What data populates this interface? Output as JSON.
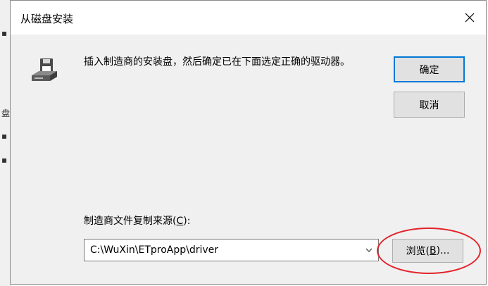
{
  "background_window": {
    "fragments": [
      "▪",
      "盘",
      "▪",
      "▪"
    ]
  },
  "dialog": {
    "title": "从磁盘安装",
    "message": "插入制造商的安装盘，然后确定已在下面选定正确的驱动器。",
    "ok_label": "确定",
    "cancel_label": "取消",
    "source_label_prefix": "制造商文件复制来源(",
    "source_label_key": "C",
    "source_label_suffix": "):",
    "source_path": "C:\\WuXin\\ETproApp\\driver",
    "browse_label_prefix": "浏览(",
    "browse_label_key": "B",
    "browse_label_suffix": ")..."
  },
  "icons": {
    "close": "close-icon",
    "disk": "floppy-drive-icon",
    "dropdown": "chevron-down-icon"
  },
  "colors": {
    "accent": "#0078d7",
    "annotation": "#e4232a"
  }
}
